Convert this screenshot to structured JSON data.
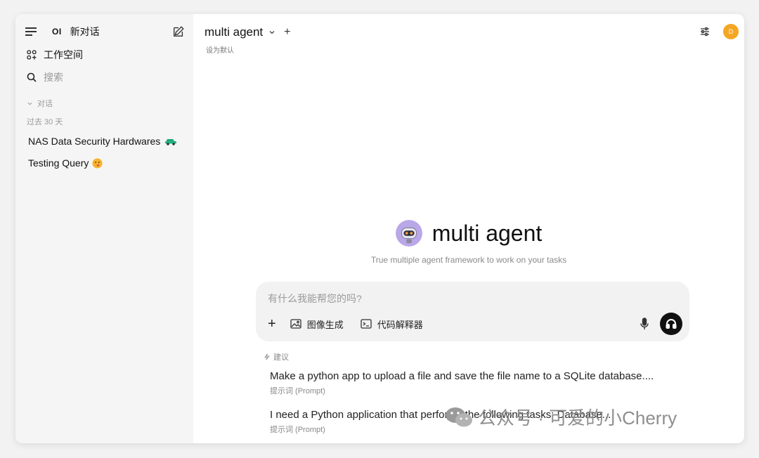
{
  "sidebar": {
    "logo": "OI",
    "new_chat": "新对话",
    "workspace": "工作空间",
    "search_placeholder": "搜索",
    "section_chats": "对话",
    "period": "过去 30 天",
    "chats": [
      {
        "title": "NAS Data Security Hardwares"
      },
      {
        "title": "Testing Query"
      }
    ]
  },
  "header": {
    "model_name": "multi agent",
    "set_default": "设为默认",
    "avatar_initial": "D"
  },
  "hero": {
    "title": "multi agent",
    "subtitle": "True multiple agent framework to work on your tasks"
  },
  "composer": {
    "placeholder": "有什么我能帮您的吗?",
    "image_gen": "图像生成",
    "code_interpreter": "代码解释器"
  },
  "suggestions": {
    "label": "建议",
    "items": [
      {
        "title": "Make a python app to upload a file and save the file name to a SQLite database....",
        "sub": "提示词 (Prompt)"
      },
      {
        "title": "I need a Python application that performs the following tasks: Database...",
        "sub": "提示词 (Prompt)"
      }
    ]
  },
  "watermark": "公众号 · 可爱的小Cherry",
  "colors": {
    "avatar": "#f5a623",
    "composer_bg": "#f2f2f2",
    "sidebar_bg": "#f5f5f5"
  }
}
